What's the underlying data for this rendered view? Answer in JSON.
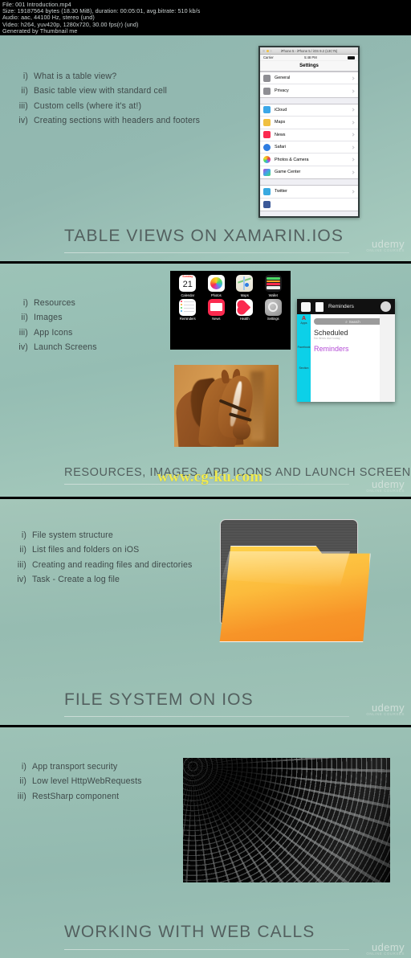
{
  "file_info": {
    "lines": [
      "File: 001 Introduction.mp4",
      "Size: 19187564 bytes (18.30 MiB), duration: 00:05:01, avg.bitrate: 510 kb/s",
      "Audio: aac, 44100 Hz, stereo (und)",
      "Video: h264, yuv420p, 1280x720, 30.00 fps(r) (und)",
      "Generated by Thumbnail me"
    ]
  },
  "watermark": {
    "text": "www.cg-ku.com"
  },
  "brand": {
    "name": "udemy",
    "tagline": "ONLINE COURSES"
  },
  "slides": [
    {
      "title": "TABLE VIEWS ON XAMARIN.IOS",
      "bullets": [
        {
          "num": "i)",
          "text": "What is a table view?"
        },
        {
          "num": "ii)",
          "text": "Basic table view with standard cell"
        },
        {
          "num": "iii)",
          "text": "Custom cells (where it's at!)"
        },
        {
          "num": "iv)",
          "text": "Creating sections with headers and footers"
        }
      ],
      "simulator": {
        "window_title": "iPhone 5 - iPhone 5 / iOS 9.2 (13C75)",
        "carrier": "Carrier",
        "time": "5:48 PM",
        "nav_title": "Settings",
        "sections": [
          [
            {
              "label": "General",
              "color": "#8e8e93"
            },
            {
              "label": "Privacy",
              "color": "#8e8e93"
            }
          ],
          [
            {
              "label": "iCloud",
              "color": "#3ba7e8"
            },
            {
              "label": "Maps",
              "color": "#f0c040"
            },
            {
              "label": "News",
              "color": "#fb2a4f"
            },
            {
              "label": "Safari",
              "color": "#2f7de1"
            },
            {
              "label": "Photos & Camera",
              "color": "#f5a623"
            },
            {
              "label": "Game Center",
              "color": "#b44bd6"
            }
          ],
          [
            {
              "label": "Twitter",
              "color": "#39a9e0"
            }
          ]
        ]
      }
    },
    {
      "title": "RESOURCES, IMAGES, APP ICONS AND LAUNCH SCREENS",
      "bullets": [
        {
          "num": "i)",
          "text": "Resources"
        },
        {
          "num": "ii)",
          "text": "Images"
        },
        {
          "num": "iii)",
          "text": "App Icons"
        },
        {
          "num": "iv)",
          "text": "Launch Screens"
        }
      ],
      "home_screen": {
        "apps": [
          {
            "name": "Calendar",
            "icon": "calendar-icon",
            "day": "Sunday",
            "date": "21"
          },
          {
            "name": "Photos",
            "icon": "photos-icon"
          },
          {
            "name": "Maps",
            "icon": "maps-icon"
          },
          {
            "name": "Wallet",
            "icon": "wallet-icon"
          },
          {
            "name": "Reminders",
            "icon": "reminders-icon"
          },
          {
            "name": "News",
            "icon": "news-icon"
          },
          {
            "name": "Health",
            "icon": "health-icon"
          },
          {
            "name": "Settings",
            "icon": "settings-icon"
          }
        ]
      },
      "reminders_window": {
        "title": "Reminders",
        "search_placeholder": "Search",
        "rail_letter": "A",
        "rail_label": "Apps",
        "rail_label2": "Facebook",
        "rail_label3": "Section",
        "list_heading": "Scheduled",
        "list_sub": "No items due today",
        "list_group": "Reminders"
      },
      "photo": {
        "alt": "horse-photo"
      }
    },
    {
      "title": "FILE SYSTEM ON IOS",
      "bullets": [
        {
          "num": "i)",
          "text": "File system structure"
        },
        {
          "num": "ii)",
          "text": "List files and folders on iOS"
        },
        {
          "num": "iii)",
          "text": "Creating and reading files and directories"
        },
        {
          "num": "iv)",
          "text": "Task - Create a log file"
        }
      ],
      "graphic": {
        "alt": "folder-icon-illustration"
      }
    },
    {
      "title": "WORKING WITH WEB CALLS",
      "bullets": [
        {
          "num": "i)",
          "text": "App transport security"
        },
        {
          "num": "ii)",
          "text": "Low level HttpWebRequests"
        },
        {
          "num": "iii)",
          "text": "RestSharp component"
        }
      ],
      "photo": {
        "alt": "spider-web-photo"
      }
    }
  ]
}
